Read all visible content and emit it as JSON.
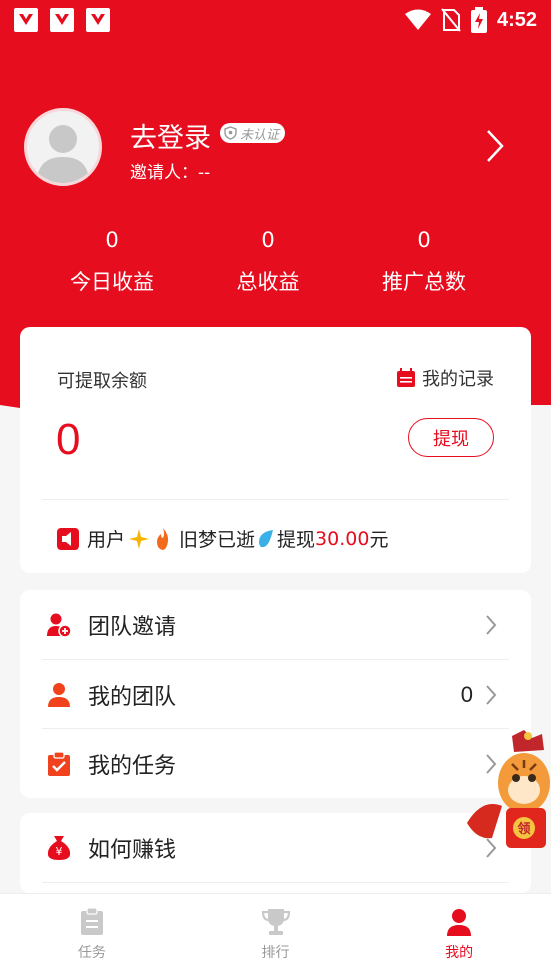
{
  "status_bar": {
    "time": "4:52"
  },
  "profile": {
    "title": "去登录",
    "badge": "未认证",
    "inviter": "邀请人：--"
  },
  "stats": [
    {
      "value": "0",
      "label": "今日收益"
    },
    {
      "value": "0",
      "label": "总收益"
    },
    {
      "value": "0",
      "label": "推广总数"
    }
  ],
  "balance": {
    "label": "可提取余额",
    "record_label": "我的记录",
    "amount": "0",
    "withdraw_label": "提现",
    "broadcast": {
      "prefix": "用户",
      "name": "旧梦已逝",
      "action": "提现",
      "amount": "30.00",
      "unit": "元"
    }
  },
  "menu": [
    {
      "label": "团队邀请",
      "icon": "user-add-icon"
    },
    {
      "label": "我的团队",
      "icon": "user-icon",
      "count": "0"
    },
    {
      "label": "我的任务",
      "icon": "clipboard-check-icon"
    }
  ],
  "menu2": [
    {
      "label": "如何赚钱",
      "icon": "money-bag-icon"
    }
  ],
  "mascot": {
    "badge": "领"
  },
  "tabs": [
    {
      "label": "任务",
      "icon": "clipboard-icon",
      "active": false
    },
    {
      "label": "排行",
      "icon": "trophy-icon",
      "active": false
    },
    {
      "label": "我的",
      "icon": "person-icon",
      "active": true
    }
  ],
  "colors": {
    "accent": "#e60d1f",
    "text": "#222222",
    "muted": "#999999"
  }
}
